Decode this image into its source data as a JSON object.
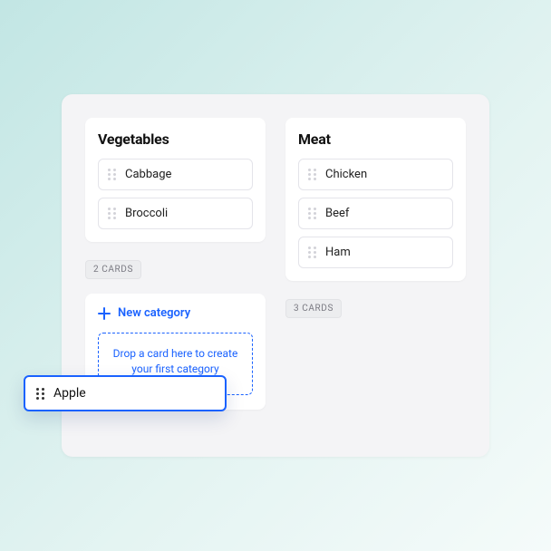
{
  "columns": [
    {
      "title": "Vegetables",
      "cards": [
        "Cabbage",
        "Broccoli"
      ],
      "countLabel": "2 CARDS",
      "showNewCategoryBelow": true
    },
    {
      "title": "Meat",
      "cards": [
        "Chicken",
        "Beef",
        "Ham"
      ],
      "countLabel": "3 CARDS",
      "showNewCategoryBelow": false
    }
  ],
  "newCategory": {
    "label": "New category",
    "dropzoneHint": "Drop a card here to create your first category"
  },
  "draggedCard": {
    "label": "Apple"
  }
}
